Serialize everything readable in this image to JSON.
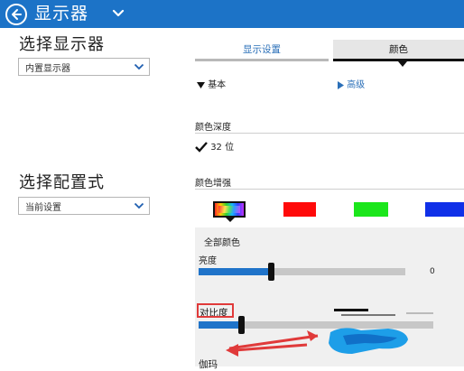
{
  "header": {
    "title": "显示器",
    "bg_color": "#1c73c7"
  },
  "monitor": {
    "section_title": "选择显示器",
    "selected": "内置显示器"
  },
  "profile": {
    "section_title": "选择配置式",
    "selected": "当前设置"
  },
  "tabs": [
    {
      "label": "显示设置",
      "active": false
    },
    {
      "label": "颜色",
      "active": true
    }
  ],
  "modes": {
    "basic": "基本",
    "advanced": "高级"
  },
  "color_depth": {
    "label": "颜色深度",
    "value": "32 位"
  },
  "color_enhance": {
    "label": "颜色增强",
    "swatches": [
      {
        "name": "all",
        "color": "rainbow"
      },
      {
        "name": "red",
        "color": "#ff0a0a"
      },
      {
        "name": "green",
        "color": "#1be61b"
      },
      {
        "name": "blue",
        "color": "#1030e8"
      }
    ]
  },
  "adjust": {
    "channel_label": "全部颜色",
    "brightness": {
      "label": "亮度",
      "value": "0",
      "level": 0.35
    },
    "contrast": {
      "label": "对比度",
      "level": 0.18
    },
    "gamma": {
      "label": "伽玛"
    }
  },
  "accent": "#1f73c9",
  "annotation_color": "#e03a3a"
}
